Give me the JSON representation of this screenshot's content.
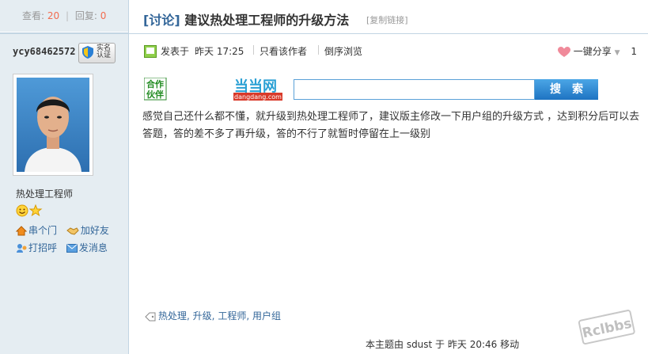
{
  "stats": {
    "views_label": "查看:",
    "views": "20",
    "replies_label": "回复:",
    "replies": "0"
  },
  "user": {
    "name": "ycy68462572",
    "badge_text": "实名认证",
    "title": "热处理工程师",
    "actions": [
      {
        "label": "串个门",
        "icon": "home-icon"
      },
      {
        "label": "加好友",
        "icon": "handshake-icon"
      },
      {
        "label": "打招呼",
        "icon": "wave-icon"
      },
      {
        "label": "发消息",
        "icon": "mail-icon"
      }
    ]
  },
  "post": {
    "category": "[讨论]",
    "title": "建议热处理工程师的升级方法",
    "copy_link": "[复制链接]",
    "posted_label": "发表于",
    "posted_time": "昨天 17:25",
    "only_author": "只看该作者",
    "reverse": "倒序浏览",
    "share_label": "一键分享",
    "floor": "1",
    "body": "感觉自己还什么都不懂，就升级到热处理工程师了，建议版主修改一下用户组的升级方式 ，达到积分后可以去答题，答的差不多了再升级，答的不行了就暂时停留在上一级别",
    "tags": [
      "热处理",
      "升级",
      "工程师",
      "用户组"
    ],
    "footer": "本主题由 sdust 于 昨天 20:46 移动"
  },
  "ad": {
    "partner": "合作伙伴",
    "brand": "当当网",
    "domain": "dangdang.com",
    "search_button": "搜索"
  },
  "watermark": "Rclbbs",
  "colors": {
    "accent": "#336699",
    "sidebar": "#e5edf2",
    "orange": "#f26c4f"
  }
}
